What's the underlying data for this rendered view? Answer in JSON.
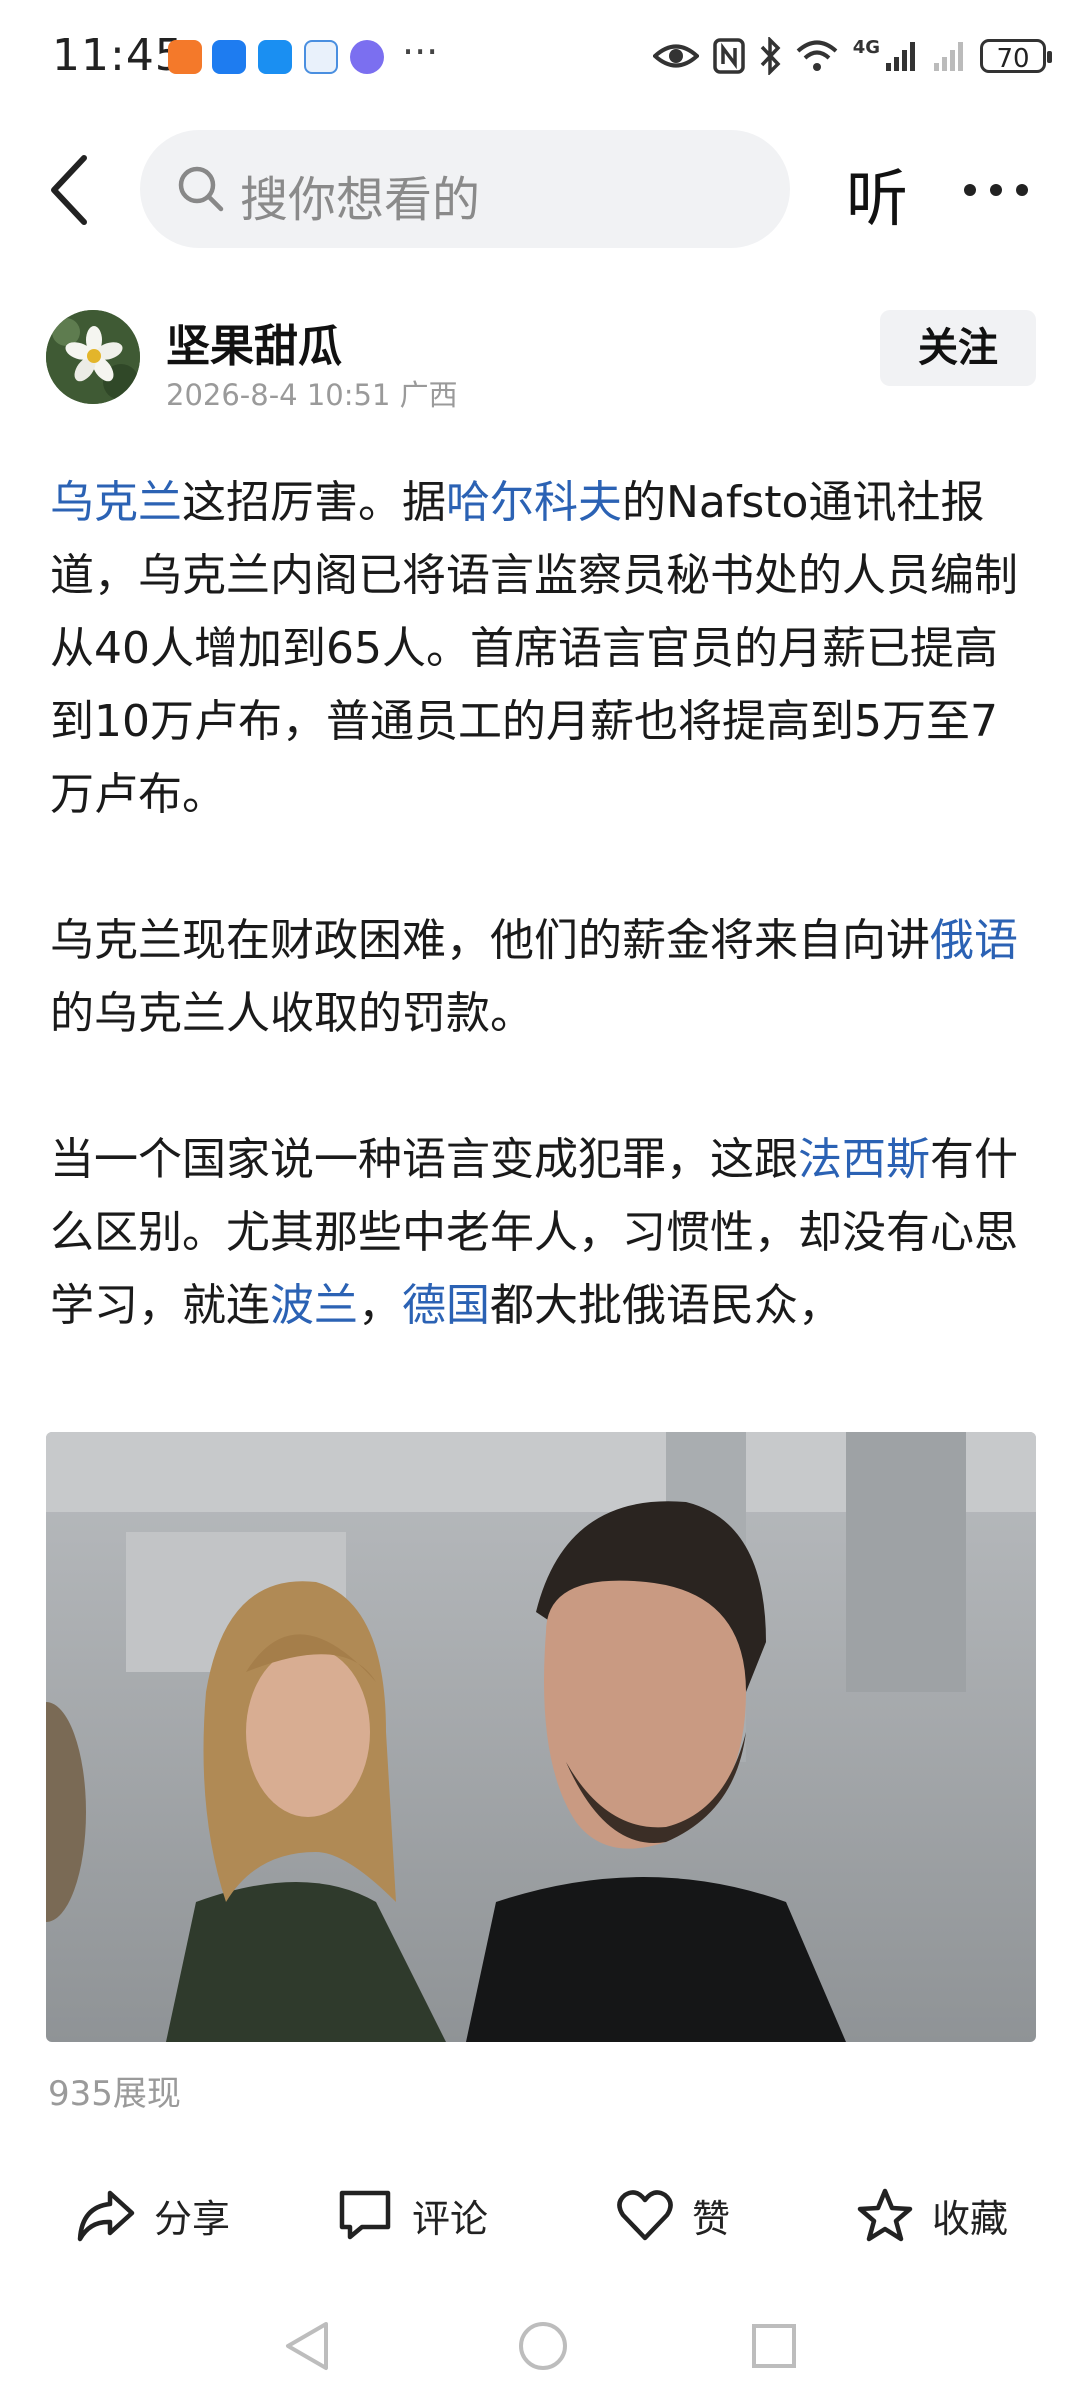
{
  "status_bar": {
    "time": "11:45",
    "more_indicator": "···",
    "network": "4G",
    "battery": "70"
  },
  "header": {
    "search_placeholder": "搜你想看的",
    "listen_label": "听"
  },
  "author": {
    "name": "坚果甜瓜",
    "meta": "2026-8-4 10:51 广西",
    "follow_label": "关注"
  },
  "article": {
    "p1": {
      "link1": "乌克兰",
      "t1": "这招厉害。据",
      "link2": "哈尔科夫",
      "t2": "的Nafsto通讯社报道，乌克兰内阁已将语言监察员秘书处的人员编制从40人增加到65人。首席语言官员的月薪已提高到10万卢布，普通员工的月薪也将提高到5万至7万卢布。"
    },
    "p2": {
      "t1": "乌克兰现在财政困难，他们的薪金将来自向讲",
      "link1": "俄语",
      "t2": "的乌克兰人收取的罚款。"
    },
    "p3": {
      "t1": "当一个国家说一种语言变成犯罪，这跟",
      "link1": "法西斯",
      "t2": "有什么区别。尤其那些中老年人，习惯性，却没有心思学习，就连",
      "link2": "波兰",
      "t3": "，",
      "link3": "德国",
      "t4": "都大批俄语民众，"
    }
  },
  "impressions": "935展现",
  "actions": {
    "share": "分享",
    "comment": "评论",
    "like": "赞",
    "favorite": "收藏"
  },
  "colors": {
    "link": "#2b62b4",
    "search_bg": "#f1f2f4",
    "meta_text": "#9a9a9a"
  },
  "icons": [
    "back-icon",
    "search-icon",
    "more-icon",
    "share-icon",
    "comment-icon",
    "heart-icon",
    "star-icon",
    "nav-back-icon",
    "nav-home-icon",
    "nav-recents-icon"
  ]
}
